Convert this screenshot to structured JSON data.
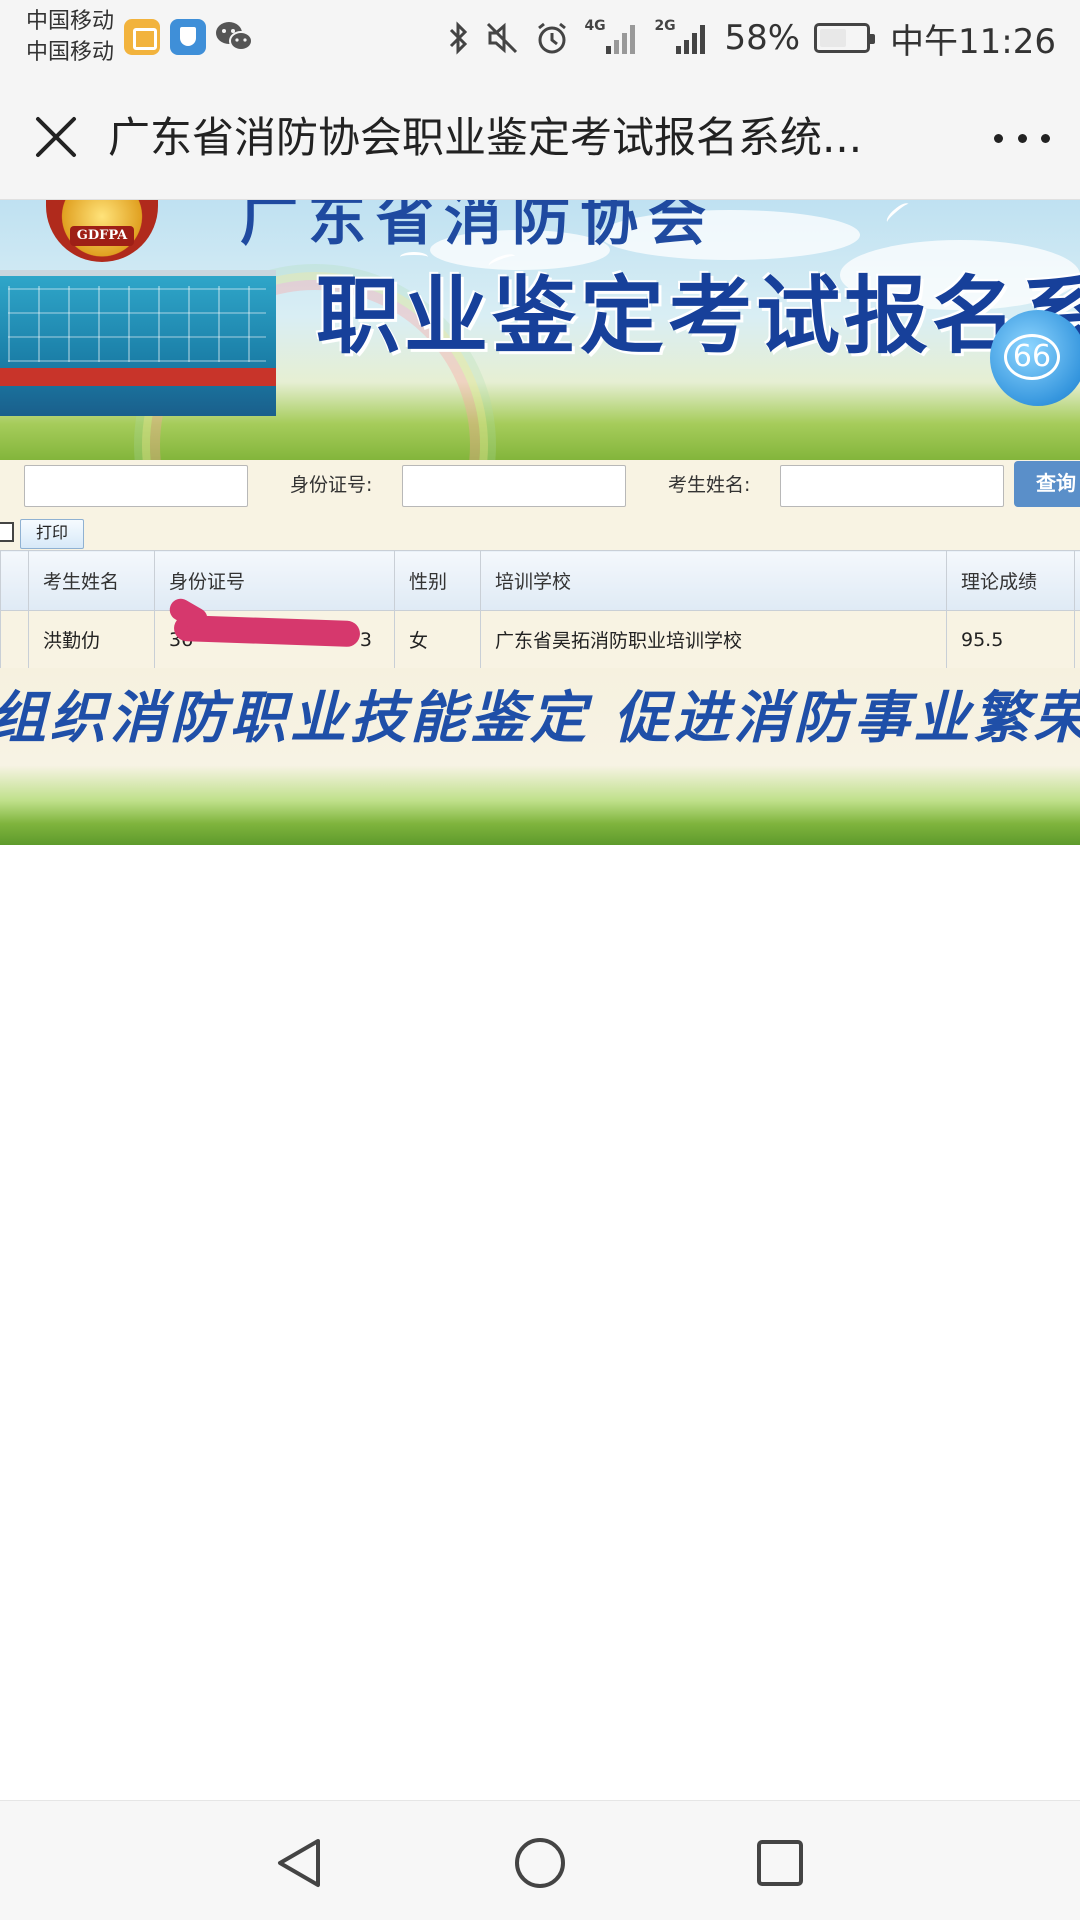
{
  "status_bar": {
    "carrier_1": "中国移动",
    "carrier_2": "中国移动",
    "signal_1_label": "4G",
    "signal_2_label": "2G",
    "battery": "58%",
    "battery_level": 0.58,
    "time": "中午11:26"
  },
  "title_bar": {
    "title": "广东省消防协会职业鉴定考试报名系统..."
  },
  "banner": {
    "org_name": "广东省消防协会",
    "emblem_text": "GDFPA",
    "headline": "职业鉴定考试报名系",
    "badge_number": "66"
  },
  "search": {
    "field1_value": "",
    "id_label": "身份证号:",
    "id_value": "",
    "name_label": "考生姓名:",
    "name_value": "",
    "query_button": "查询",
    "print_button": "打印"
  },
  "table": {
    "headers": [
      "",
      "考生姓名",
      "身份证号",
      "性别",
      "培训学校",
      "理论成绩",
      ""
    ],
    "rows": [
      [
        "",
        "洪勤仂",
        "36",
        "女",
        "广东省昊拓消防职业培训学校",
        "95.5",
        ""
      ]
    ],
    "id_tail": "3"
  },
  "slogan": {
    "text": "组织消防职业技能鉴定 促进消防事业繁荣发展"
  },
  "colors": {
    "accent": "#1f4fa8",
    "query_button": "#5a8fc9",
    "redaction": "#d6386d",
    "row_background": "#f8f3e3"
  },
  "icons": {
    "close": "close-icon",
    "more": "more-icon",
    "back": "back-icon",
    "home": "home-icon",
    "recents": "recents-icon"
  }
}
